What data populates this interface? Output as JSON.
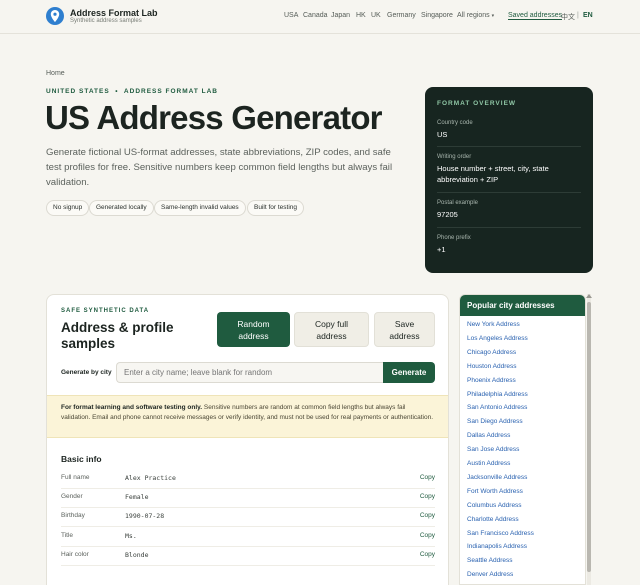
{
  "header": {
    "brand_title": "Address Format Lab",
    "brand_sub": "Synthetic address samples",
    "nav": [
      "USA",
      "Canada",
      "Japan",
      "HK",
      "UK",
      "Germany",
      "Singapore",
      "All regions"
    ],
    "saved": "Saved addresses",
    "lang_zh": "中文",
    "lang_sep": "|",
    "lang_en": "EN"
  },
  "breadcrumb": "Home",
  "hero": {
    "eyebrow": "UNITED STATES  •  ADDRESS FORMAT LAB",
    "title": "US Address Generator",
    "description": "Generate fictional US-format addresses, state abbreviations, ZIP codes, and safe test profiles for free. Sensitive numbers keep common field lengths but always fail validation.",
    "chips": [
      "No signup",
      "Generated locally",
      "Same-length invalid values",
      "Built for testing"
    ]
  },
  "overview": {
    "title": "FORMAT OVERVIEW",
    "items": [
      {
        "label": "Country code",
        "value": "US"
      },
      {
        "label": "Writing order",
        "value": "House number + street, city, state abbreviation + ZIP"
      },
      {
        "label": "Postal example",
        "value": "97205"
      },
      {
        "label": "Phone prefix",
        "value": "+1"
      }
    ]
  },
  "card": {
    "eyebrow": "SAFE SYNTHETIC DATA",
    "title": "Address & profile samples",
    "buttons": {
      "random": "Random address",
      "copy": "Copy full address",
      "save": "Save address"
    },
    "city_label": "Generate by city",
    "city_placeholder": "Enter a city name; leave blank for random",
    "generate": "Generate",
    "notice_bold": "For format learning and software testing only.",
    "notice_rest": " Sensitive numbers are random at common field lengths but always fail validation. Email and phone cannot receive messages or verify identity, and must not be used for real payments or authentication.",
    "basic_title": "Basic info",
    "copy_label": "Copy",
    "rows": [
      {
        "label": "Full name",
        "value": "Alex Practice"
      },
      {
        "label": "Gender",
        "value": "Female"
      },
      {
        "label": "Birthday",
        "value": "1990-07-28"
      },
      {
        "label": "Title",
        "value": "Ms."
      },
      {
        "label": "Hair color",
        "value": "Blonde"
      }
    ]
  },
  "sidebar": {
    "title": "Popular city addresses",
    "items": [
      "New York Address",
      "Los Angeles Address",
      "Chicago Address",
      "Houston Address",
      "Phoenix Address",
      "Philadelphia Address",
      "San Antonio Address",
      "San Diego Address",
      "Dallas Address",
      "San Jose Address",
      "Austin Address",
      "Jacksonville Address",
      "Fort Worth Address",
      "Columbus Address",
      "Charlotte Address",
      "San Francisco Address",
      "Indianapolis Address",
      "Seattle Address",
      "Denver Address"
    ]
  },
  "colors": {
    "accent": "#1f5b3f",
    "overview_bg": "#172520",
    "link": "#2a62b0",
    "notice_bg": "#fbf4d8"
  }
}
